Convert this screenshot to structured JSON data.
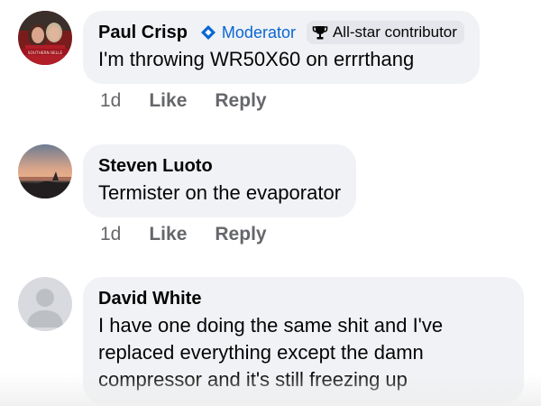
{
  "comments": [
    {
      "author": "Paul Crisp",
      "moderator_label": "Moderator",
      "contributor_label": "All-star contributor",
      "avatar_caption": "SOUTHERN BELLE",
      "text": "I'm throwing WR50X60 on errrthang",
      "time": "1d",
      "like_label": "Like",
      "reply_label": "Reply"
    },
    {
      "author": "Steven Luoto",
      "text": "Termister on the evaporator",
      "time": "1d",
      "like_label": "Like",
      "reply_label": "Reply"
    },
    {
      "author": "David White",
      "text_lines": [
        "I have one doing the same shit and I've",
        "replaced everything except the damn",
        "compressor and it's still freezing up"
      ]
    }
  ],
  "colors": {
    "bubble": "#f0f2f5",
    "moderator_blue": "#0a66d4",
    "meta_gray": "#65676b"
  },
  "icons": [
    "moderator-diamond-icon",
    "trophy-icon",
    "default-avatar-icon"
  ]
}
